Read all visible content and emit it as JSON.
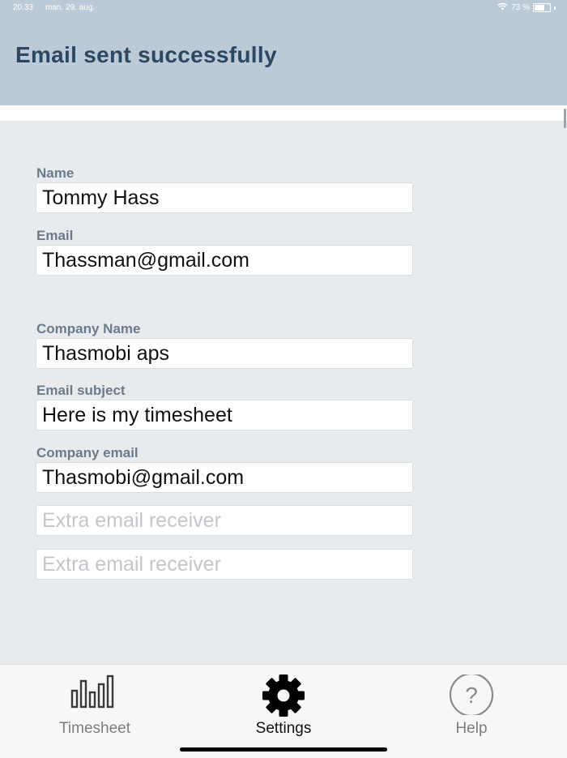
{
  "status_bar": {
    "time": "20.33",
    "date": "man. 29. aug.",
    "battery": "73 %",
    "battery_level": 0.73
  },
  "header": {
    "title": "Email sent successfully"
  },
  "form": {
    "name": {
      "label": "Name",
      "value": "Tommy Hass"
    },
    "email": {
      "label": "Email",
      "value": "Thassman@gmail.com"
    },
    "company_name": {
      "label": "Company Name",
      "value": "Thasmobi aps"
    },
    "email_subject": {
      "label": "Email subject",
      "value": "Here is my timesheet"
    },
    "company_email": {
      "label": "Company email",
      "value": "Thasmobi@gmail.com"
    },
    "extra_receiver_1": {
      "value": "",
      "placeholder": "Extra email receiver"
    },
    "extra_receiver_2": {
      "value": "",
      "placeholder": "Extra email receiver"
    }
  },
  "tab_bar": {
    "active": "settings",
    "tabs": [
      {
        "id": "timesheet",
        "label": "Timesheet",
        "icon": "bar-chart-icon"
      },
      {
        "id": "settings",
        "label": "Settings",
        "icon": "gear-icon"
      },
      {
        "id": "help",
        "label": "Help",
        "icon": "question-circle-icon"
      }
    ]
  },
  "colors": {
    "header_bg": "#bcc9d6",
    "title": "#2b4761",
    "label": "#6b7b8a",
    "page_bg": "#e8ebee"
  }
}
